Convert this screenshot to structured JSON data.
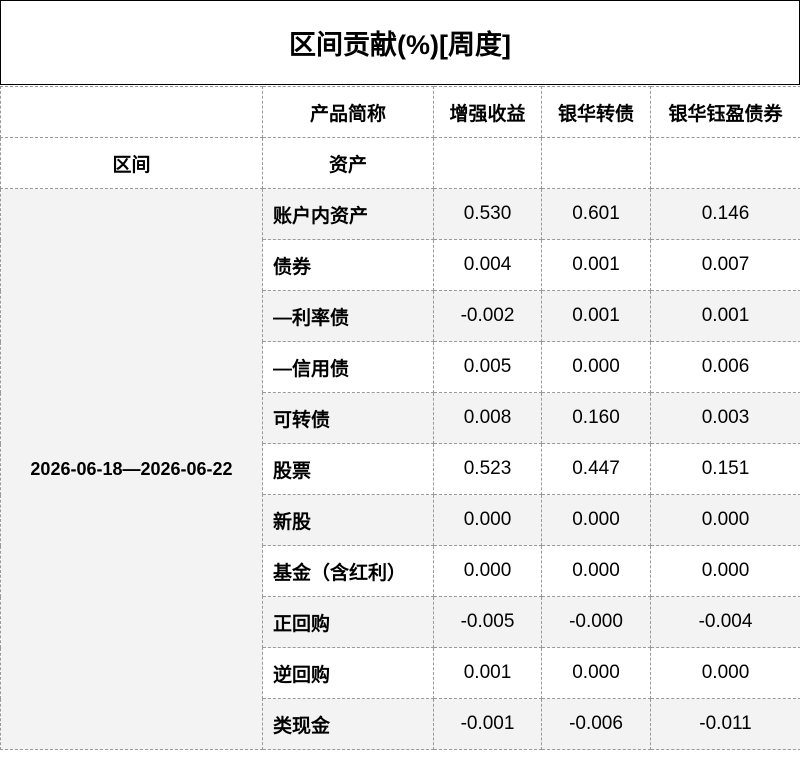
{
  "title": "区间贡献(%)[周度]",
  "header": {
    "product_label": "产品简称",
    "products": [
      "增强收益",
      "银华转债",
      "银华钰盈债券"
    ],
    "period_label": "区间",
    "asset_label": "资产"
  },
  "period": "2026-06-18—2026-06-22",
  "rows": [
    {
      "asset": "账户内资产",
      "values": [
        "0.530",
        "0.601",
        "0.146"
      ]
    },
    {
      "asset": "债券",
      "values": [
        "0.004",
        "0.001",
        "0.007"
      ]
    },
    {
      "asset": "—利率债",
      "values": [
        "-0.002",
        "0.001",
        "0.001"
      ]
    },
    {
      "asset": "—信用债",
      "values": [
        "0.005",
        "0.000",
        "0.006"
      ]
    },
    {
      "asset": "可转债",
      "values": [
        "0.008",
        "0.160",
        "0.003"
      ]
    },
    {
      "asset": "股票",
      "values": [
        "0.523",
        "0.447",
        "0.151"
      ]
    },
    {
      "asset": "新股",
      "values": [
        "0.000",
        "0.000",
        "0.000"
      ]
    },
    {
      "asset": "基金（含红利）",
      "values": [
        "0.000",
        "0.000",
        "0.000"
      ]
    },
    {
      "asset": "正回购",
      "values": [
        "-0.005",
        "-0.000",
        "-0.004"
      ]
    },
    {
      "asset": "逆回购",
      "values": [
        "0.001",
        "0.000",
        "0.000"
      ]
    },
    {
      "asset": "类现金",
      "values": [
        "-0.001",
        "-0.006",
        "-0.011"
      ]
    }
  ],
  "colors": {
    "shade": "#f3f3f3",
    "border": "#9a9a9a"
  }
}
